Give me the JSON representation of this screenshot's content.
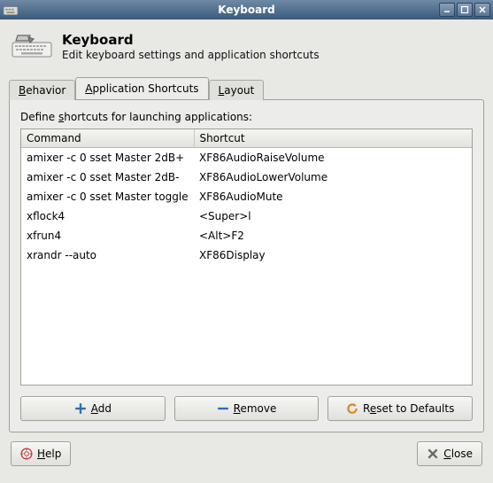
{
  "window": {
    "title": "Keyboard"
  },
  "header": {
    "title": "Keyboard",
    "subtitle": "Edit keyboard settings and application shortcuts"
  },
  "tabs": {
    "behavior": "Behavior",
    "shortcuts": "Application Shortcuts",
    "layout": "Layout",
    "active": "shortcuts"
  },
  "panel": {
    "define_prefix": "Define ",
    "define_ul": "s",
    "define_suffix": "hortcuts for launching applications:",
    "columns": {
      "command": "Command",
      "shortcut": "Shortcut"
    },
    "rows": [
      {
        "command": "amixer -c 0 sset Master 2dB+",
        "shortcut": "XF86AudioRaiseVolume"
      },
      {
        "command": "amixer -c 0 sset Master 2dB-",
        "shortcut": "XF86AudioLowerVolume"
      },
      {
        "command": "amixer -c 0 sset Master toggle",
        "shortcut": "XF86AudioMute"
      },
      {
        "command": "xflock4",
        "shortcut": "<Super>l"
      },
      {
        "command": "xfrun4",
        "shortcut": "<Alt>F2"
      },
      {
        "command": "xrandr --auto",
        "shortcut": "XF86Display"
      }
    ]
  },
  "buttons": {
    "add_ul": "A",
    "add_suffix": "dd",
    "remove_ul": "R",
    "remove_suffix": "emove",
    "reset_prefix": "R",
    "reset_ul": "e",
    "reset_suffix": "set to Defaults",
    "help_ul": "H",
    "help_suffix": "elp",
    "close_ul": "C",
    "close_suffix": "lose"
  }
}
